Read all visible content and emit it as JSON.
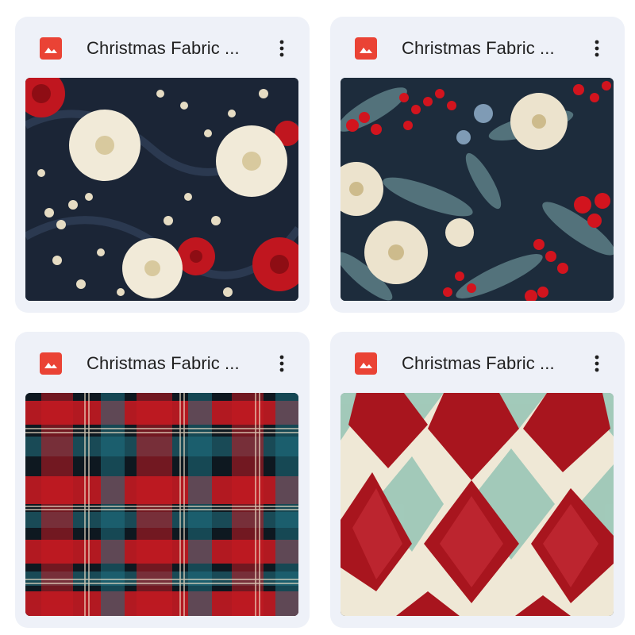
{
  "files": [
    {
      "name": "Christmas Fabric ...",
      "icon": "image-file-icon",
      "menu_icon": "more-vert-icon",
      "thumbnail": "floral-red-white-pattern"
    },
    {
      "name": "Christmas Fabric ...",
      "icon": "image-file-icon",
      "menu_icon": "more-vert-icon",
      "thumbnail": "berry-foliage-pattern"
    },
    {
      "name": "Christmas Fabric ...",
      "icon": "image-file-icon",
      "menu_icon": "more-vert-icon",
      "thumbnail": "red-teal-plaid-pattern"
    },
    {
      "name": "Christmas Fabric ...",
      "icon": "image-file-icon",
      "menu_icon": "more-vert-icon",
      "thumbnail": "red-cream-diamond-pattern"
    }
  ],
  "colors": {
    "card_background": "#eef1f8",
    "icon_red": "#ea4335",
    "text": "#1f1f1f"
  }
}
